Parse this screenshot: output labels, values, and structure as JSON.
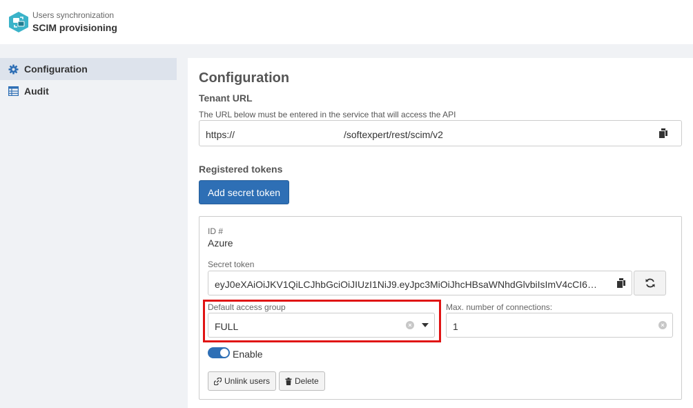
{
  "header": {
    "subtitle": "Users synchronization",
    "title": "SCIM provisioning"
  },
  "sidebar": {
    "items": [
      {
        "label": "Configuration",
        "icon": "gear-icon",
        "active": true
      },
      {
        "label": "Audit",
        "icon": "table-icon",
        "active": false
      }
    ]
  },
  "main": {
    "heading": "Configuration",
    "tenant": {
      "heading": "Tenant URL",
      "description": "The URL below must be entered in the service that will access the API",
      "url_prefix": "https://",
      "url_suffix": "/softexpert/rest/scim/v2"
    },
    "tokens": {
      "heading": "Registered tokens",
      "add_button": "Add secret token"
    },
    "token_card": {
      "id_label": "ID #",
      "id_value": "Azure",
      "secret_label": "Secret token",
      "secret_value": "eyJ0eXAiOiJKV1QiLCJhbGciOiJIUzI1NiJ9.eyJpc3MiOiJhcHBsaWNhdGlvbiIsImV4cCI6…",
      "access_group_label": "Default access group",
      "access_group_value": "FULL",
      "max_connections_label": "Max. number of connections:",
      "max_connections_value": "1",
      "enable_label": "Enable",
      "enabled": true,
      "unlink_button": "Unlink users",
      "delete_button": "Delete"
    }
  },
  "colors": {
    "accent": "#2e6fb5",
    "sidebar_bg": "#f0f2f5",
    "sidebar_active": "#dde3ec",
    "highlight": "#e01313",
    "logo": "#3ab3c9"
  }
}
